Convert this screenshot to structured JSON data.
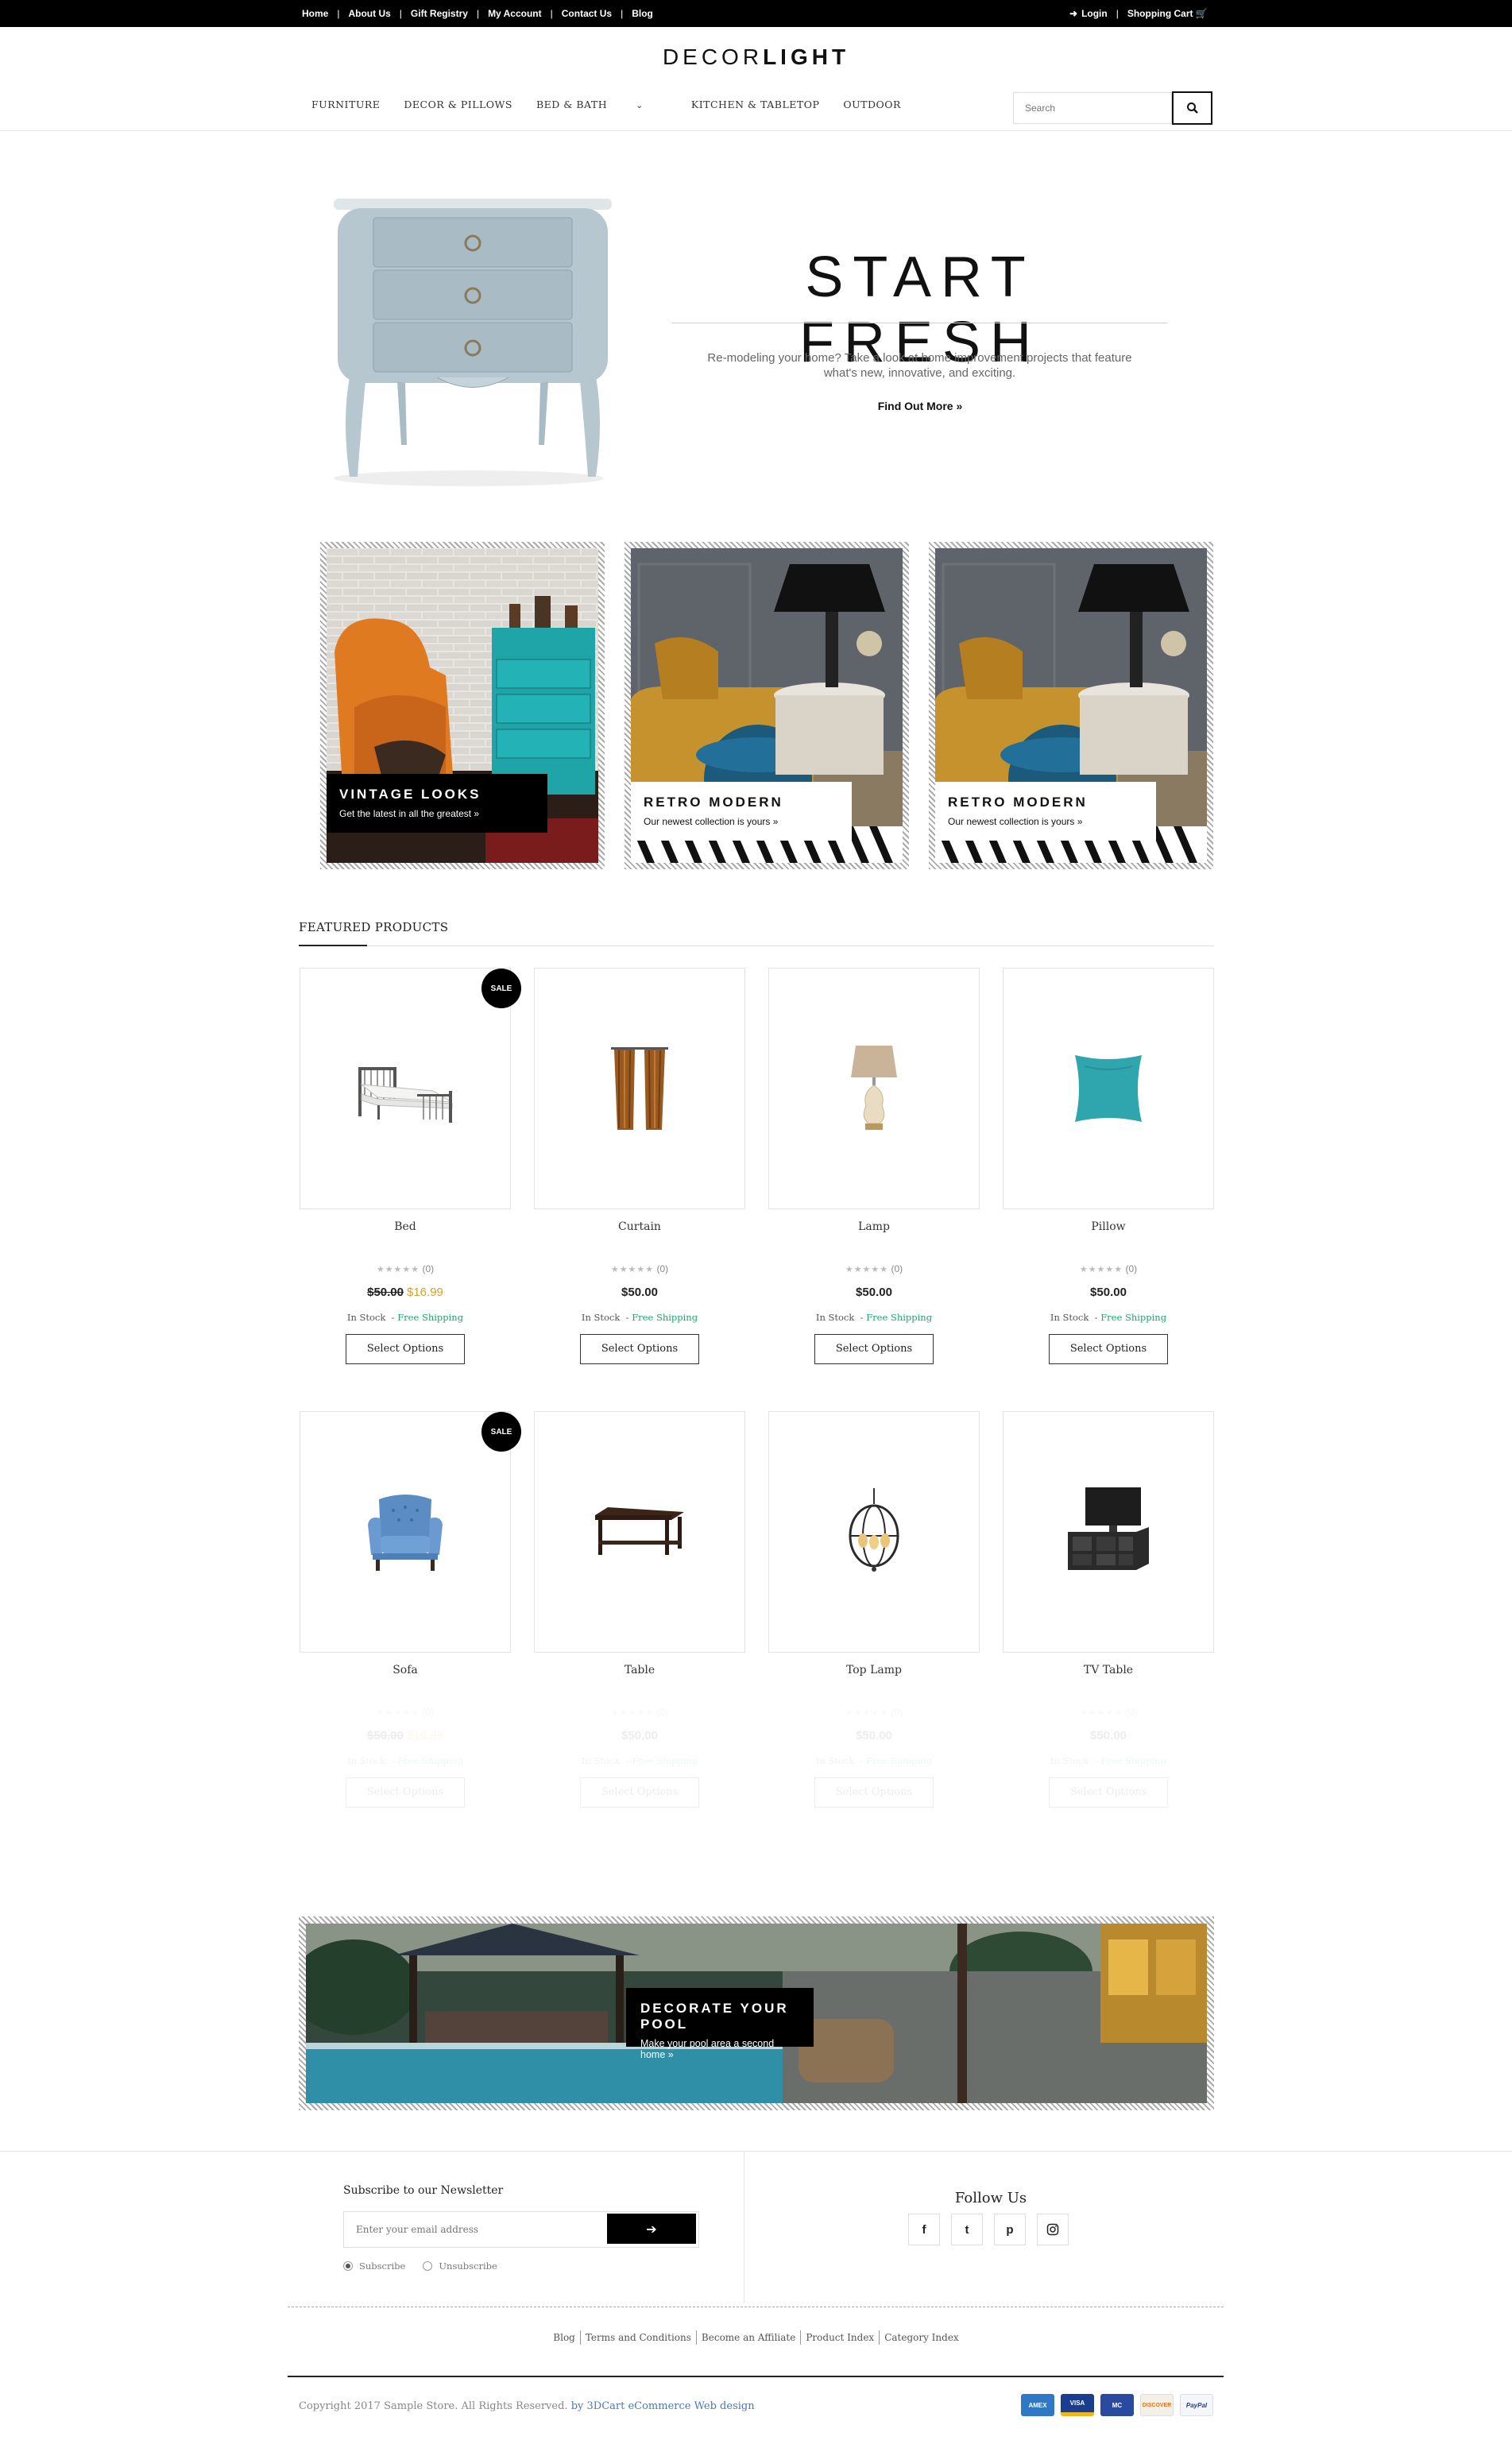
{
  "topbar": {
    "links": [
      "Home",
      "About Us",
      "Gift Registry",
      "My Account",
      "Contact Us",
      "Blog"
    ],
    "login": "Login",
    "cart": "Shopping Cart"
  },
  "logo": {
    "part1": "DECOR",
    "part2": "LIGHT"
  },
  "nav": {
    "items": [
      "FURNITURE",
      "DECOR & PILLOWS",
      "BED & BATH",
      "KITCHEN & TABLETOP",
      "OUTDOOR"
    ],
    "search_placeholder": "Search"
  },
  "hero": {
    "title": "START FRESH",
    "text": "Re-modeling your home? Take a look at home improvement projects that feature what's new, innovative, and exciting.",
    "link": "Find Out More »"
  },
  "banners": [
    {
      "title": "VINTAGE LOOKS",
      "subtitle": "Get the latest in all the greatest »"
    },
    {
      "title": "RETRO MODERN",
      "subtitle": "Our newest collection is yours »"
    },
    {
      "title": "RETRO MODERN",
      "subtitle": "Our newest collection is yours »"
    }
  ],
  "featured": {
    "title": "FEATURED PRODUCTS",
    "sale_label": "SALE",
    "products": [
      {
        "name": "Bed",
        "rating": "(0)",
        "old_price": "$50.00",
        "price": "$16.99",
        "stock": "In Stock",
        "shipping": "Free Shipping",
        "button": "Select Options",
        "icon": "bed-icon"
      },
      {
        "name": "Curtain",
        "rating": "(0)",
        "price": "$50.00",
        "stock": "In Stock",
        "shipping": "Free Shipping",
        "button": "Select Options",
        "icon": "curtain-icon"
      },
      {
        "name": "Lamp",
        "rating": "(0)",
        "price": "$50.00",
        "stock": "In Stock",
        "shipping": "Free Shipping",
        "button": "Select Options",
        "icon": "lamp-icon"
      },
      {
        "name": "Pillow",
        "rating": "(0)",
        "price": "$50.00",
        "stock": "In Stock",
        "shipping": "Free Shipping",
        "button": "Select Options",
        "icon": "pillow-icon"
      },
      {
        "name": "Sofa",
        "rating": "(0)",
        "old_price": "$50.00",
        "price": "$16.99",
        "stock": "In Stock",
        "shipping": "Free Shipping",
        "button": "Select Options",
        "icon": "armchair-icon"
      },
      {
        "name": "Table",
        "rating": "(0)",
        "price": "$50.00",
        "stock": "In Stock",
        "shipping": "Free Shipping",
        "button": "Select Options",
        "icon": "table-icon"
      },
      {
        "name": "Top Lamp",
        "rating": "(0)",
        "price": "$50.00",
        "stock": "In Stock",
        "shipping": "Free Shipping",
        "button": "Select Options",
        "icon": "chandelier-icon"
      },
      {
        "name": "TV Table",
        "rating": "(0)",
        "price": "$50.00",
        "stock": "In Stock",
        "shipping": "Free Shipping",
        "button": "Select Options",
        "icon": "tv-stand-icon"
      }
    ]
  },
  "pool": {
    "title": "DECORATE YOUR POOL",
    "subtitle": "Make your pool area a second home »"
  },
  "footer": {
    "newsletter_title": "Subscribe to our Newsletter",
    "email_placeholder": "Enter your email address",
    "subscribe": "Subscribe",
    "unsubscribe": "Unsubscribe",
    "follow_title": "Follow Us",
    "social": [
      "f",
      "t",
      "p",
      "ig"
    ],
    "links": [
      "Blog",
      "Terms and Conditions",
      "Become an Affiliate",
      "Product Index",
      "Category Index"
    ],
    "copyright": "Copyright 2017 Sample Store. All Rights Reserved.",
    "credit": "by 3DCart eCommerce Web design",
    "payment": [
      "AMEX",
      "VISA",
      "MC",
      "DISCOVER",
      "PayPal"
    ]
  }
}
